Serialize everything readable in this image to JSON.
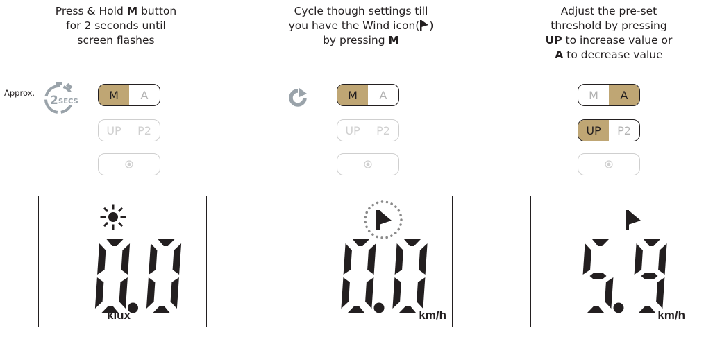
{
  "steps": [
    {
      "instruction_parts": [
        "Press & Hold ",
        "M",
        " button",
        "for 2 seconds until",
        "screen flashes"
      ],
      "approx_label": "Approx.",
      "timer_text": "2",
      "timer_subtext": "SECS",
      "buttons": {
        "m": "M",
        "a": "A",
        "up": "UP",
        "p2": "P2"
      },
      "display": {
        "icon": "sun-icon",
        "value": "0.0",
        "unit": "klux"
      }
    },
    {
      "instruction_parts": [
        "Cycle though settings till",
        "you have the Wind icon(",
        ")",
        "by pressing ",
        "M"
      ],
      "buttons": {
        "m": "M",
        "a": "A",
        "up": "UP",
        "p2": "P2"
      },
      "display": {
        "icon": "wind-flag-icon",
        "value": "0.0",
        "unit": "km/h"
      }
    },
    {
      "instruction_parts": [
        "Adjust the pre-set",
        "threshold by pressing",
        "UP",
        " to increase value or",
        "A",
        " to decrease value"
      ],
      "buttons": {
        "m": "M",
        "a": "A",
        "up": "UP",
        "p2": "P2"
      },
      "display": {
        "icon": "wind-flag-icon",
        "value": "5.9",
        "unit": "km/h"
      }
    }
  ],
  "colors": {
    "accent": "#bfa674",
    "ink": "#231f20",
    "faded": "#cfcfcf",
    "cycle": "#9aa3aa"
  }
}
